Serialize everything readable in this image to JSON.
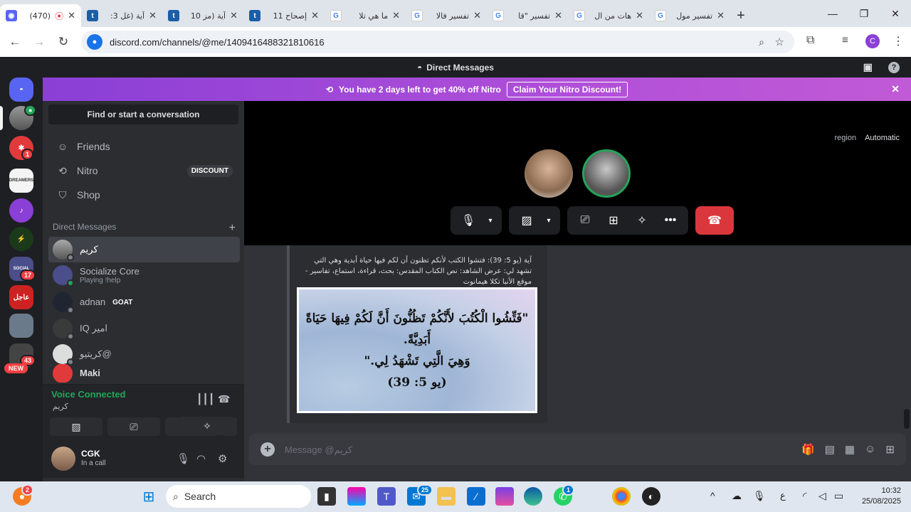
{
  "browser": {
    "tabs": [
      {
        "title": "(470)",
        "icon": "discord-favicon",
        "active": true
      },
      {
        "title": "آية (غل 3:",
        "icon": "t-favicon"
      },
      {
        "title": "آية (مز 10",
        "icon": "t-favicon"
      },
      {
        "title": "إصحاح 11",
        "icon": "t-favicon"
      },
      {
        "title": "ما هي تلا",
        "icon": "google-favicon"
      },
      {
        "title": "تفسير فالا",
        "icon": "google-favicon"
      },
      {
        "title": "تفسير \"قا",
        "icon": "google-favicon"
      },
      {
        "title": "هات من ال",
        "icon": "google-favicon"
      },
      {
        "title": "تفسير مول",
        "icon": "google-favicon"
      }
    ],
    "url": "discord.com/channels/@me/1409416488321810616",
    "profile_initial": "C"
  },
  "discord": {
    "window_title": "Direct Messages",
    "nitro_banner": {
      "text": "You have 2 days left to get 40% off Nitro",
      "button": "Claim Your Nitro Discount!"
    },
    "servers": [
      {
        "name": "home-server",
        "color": "#5865f2"
      },
      {
        "name": "user-avatar-server",
        "color": "#6b6b6b",
        "badge": ""
      },
      {
        "name": "red-server",
        "color": "#e03a3a",
        "badge": "1"
      },
      {
        "name": "dreamers-server",
        "color": "#f4f4f4"
      },
      {
        "name": "music-server",
        "color": "#8a3fd6"
      },
      {
        "name": "green-server",
        "color": "#1a7a3a"
      },
      {
        "name": "socialize-server",
        "color": "#4a4e8a",
        "badge": "17"
      },
      {
        "name": "news-server",
        "color": "#cc2222"
      },
      {
        "name": "photo-server",
        "color": "#6a7a8a"
      },
      {
        "name": "new-server",
        "color": "#444",
        "badge": "43",
        "label": "NEW"
      }
    ],
    "dm_panel": {
      "search": "Find or start a conversation",
      "nav": [
        {
          "label": "Friends",
          "icon": "friends-icon"
        },
        {
          "label": "Nitro",
          "icon": "nitro-icon",
          "badge": "DISCOUNT"
        },
        {
          "label": "Shop",
          "icon": "shop-icon"
        }
      ],
      "header": "Direct Messages",
      "dms": [
        {
          "name": "كريم",
          "active": true,
          "status": "#80848e"
        },
        {
          "name": "Socialize Core",
          "sub": "Playing !help",
          "status": "#23a55a"
        },
        {
          "name": "adnan",
          "tag": "GOAT",
          "status": "#80848e"
        },
        {
          "name": "IQ امير",
          "status": "#80848e"
        },
        {
          "name": "كريتيو@",
          "status": "#80848e"
        },
        {
          "name": "Maki",
          "status": "#80848e"
        }
      ]
    },
    "voice": {
      "status": "Voice Connected",
      "channel": "كريم"
    },
    "user": {
      "name": "CGK",
      "status": "In a call"
    },
    "call": {
      "region_label": "region",
      "region_value": "Automatic"
    },
    "chat": {
      "embed_text": "آية (يو 5: 39): فتشوا الكتب لأنكم تظنون أن لكم فيها حياة أبدية وهي التي تشهد لي: عرض الشاهد: نص الكتاب المقدس: بحث، قراءة، استماع، تفاسير - موقع الأنبا تكلا هيمانوت",
      "verse_line1": "\"فَتِّشُوا الْكُتُبَ لأَنَّكُمْ تَظُنُّونَ أَنَّ لَكُمْ فِيهَا حَيَاةً أَبَدِيَّةً.",
      "verse_line2": "وَهِيَ الَّتِي تَشْهَدُ لِي.\"",
      "verse_ref": "(يو 5: 39)",
      "message_placeholder": "Message @كريم"
    }
  },
  "taskbar": {
    "search": "Search",
    "time": "10:32",
    "date": "25/08/2025",
    "lang": "ع",
    "mail_badge": "25",
    "whatsapp_badge": "1",
    "edge_badge": "2"
  }
}
